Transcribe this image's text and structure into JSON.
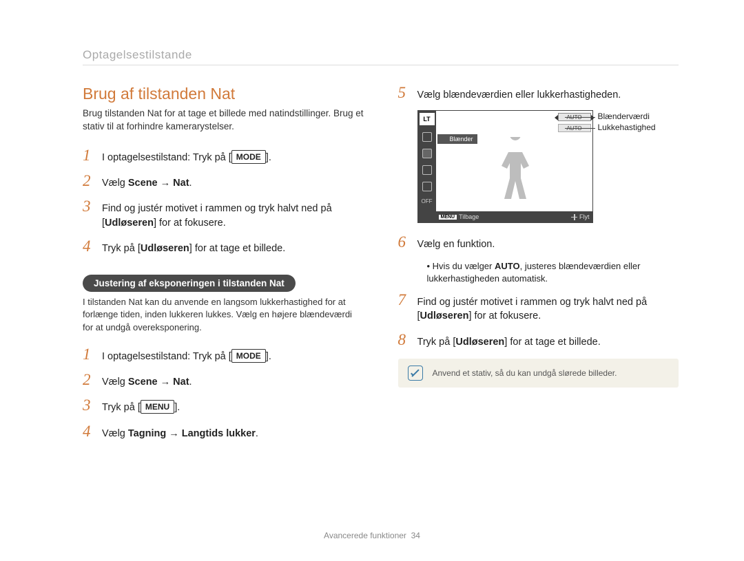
{
  "breadcrumb": "Optagelsestilstande",
  "title": "Brug af tilstanden Nat",
  "intro": "Brug tilstanden Nat for at tage et billede med natindstillinger. Brug et stativ til at forhindre kamerarystelser.",
  "stepsA": {
    "s1_pre": "I optagelsestilstand: Tryk på [",
    "s1_key": "MODE",
    "s1_post": "].",
    "s2_pre": "Vælg ",
    "s2_bold": "Scene → Nat",
    "s2_post": ".",
    "s3_a": "Find og justér motivet i rammen og tryk halvt ned på [",
    "s3_b": "Udløseren",
    "s3_c": "] for at fokusere.",
    "s4_a": "Tryk på [",
    "s4_b": "Udløseren",
    "s4_c": "] for at tage et billede."
  },
  "pill": "Justering af eksponeringen i tilstanden Nat",
  "subtext": "I tilstanden Nat kan du anvende en langsom lukkerhastighed for at forlænge tiden, inden lukkeren lukkes. Vælg en højere blændeværdi for at undgå overeksponering.",
  "stepsB": {
    "s1_pre": "I optagelsestilstand: Tryk på [",
    "s1_key": "MODE",
    "s1_post": "].",
    "s2_pre": "Vælg ",
    "s2_bold": "Scene → Nat",
    "s2_post": ".",
    "s3_pre": "Tryk på [",
    "s3_key": "MENU",
    "s3_post": "].",
    "s4_pre": "Vælg ",
    "s4_bold": "Tagning → Langtids lukker",
    "s4_post": "."
  },
  "right": {
    "s5": "Vælg blændeværdien eller lukkerhastigheden.",
    "s6": "Vælg en funktion.",
    "s6_note_a": "Hvis du vælger ",
    "s6_note_b": "AUTO",
    "s6_note_c": ", justeres blændeværdien eller lukkerhastigheden automatisk.",
    "s7_a": "Find og justér motivet i rammen og tryk halvt ned på [",
    "s7_b": "Udløseren",
    "s7_c": "] for at fokusere.",
    "s8_a": "Tryk på [",
    "s8_b": "Udløseren",
    "s8_c": "] for at tage et billede."
  },
  "screen": {
    "lt": "LT",
    "auto1": "AUTO",
    "auto2": "AUTO",
    "blaender": "Blænder",
    "menu": "MENU",
    "back": "Tilbage",
    "move": "Flyt",
    "callout1": "Blænderværdi",
    "callout2": "Lukkehastighed"
  },
  "nums": {
    "n1": "1",
    "n2": "2",
    "n3": "3",
    "n4": "4",
    "n5": "5",
    "n6": "6",
    "n7": "7",
    "n8": "8"
  },
  "tip": "Anvend et stativ, så du kan undgå slørede billeder.",
  "footer_label": "Avancerede funktioner",
  "footer_page": "34"
}
